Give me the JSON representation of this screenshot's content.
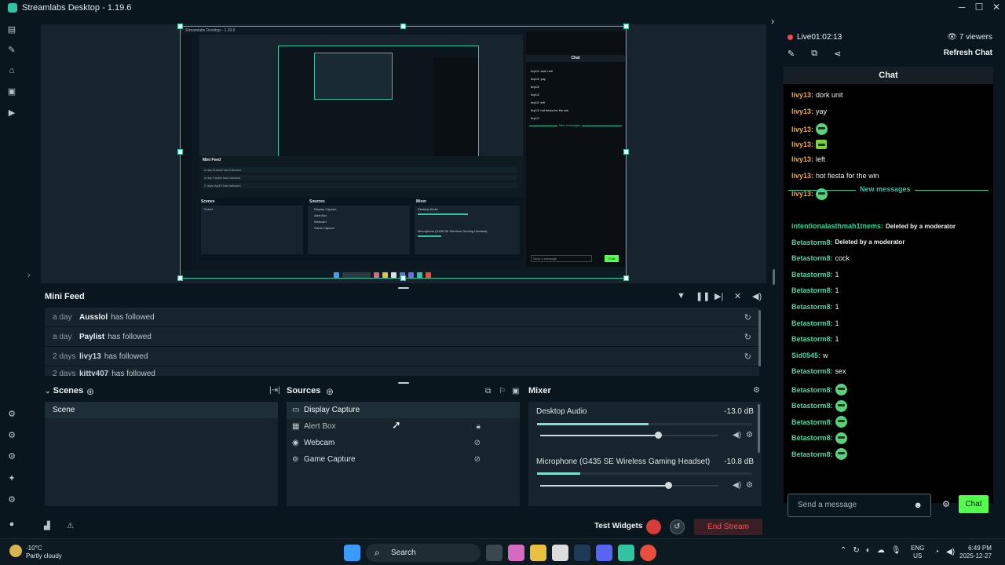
{
  "window": {
    "title": "Streamlabs Desktop - 1.19.6"
  },
  "rail_icons": [
    "editor-icon",
    "themes-icon",
    "store-icon",
    "layout-icon",
    "play-icon",
    "highlighter-icon",
    "apps-icon",
    "collab-icon",
    "sparkle-icon",
    "settings-icon",
    "profile-icon"
  ],
  "nested": {
    "title": "Streamlabs Desktop - 1.19.6",
    "feed_title": "Mini Feed",
    "feed_lines": [
      "a day  Ausslol  has followed",
      "a day  Paylist  has followed",
      "2 days  livy13  has followed"
    ],
    "scenes": "Scenes",
    "sources": "Sources",
    "mixer": "Mixer",
    "scene": "Scene",
    "source_rows": [
      "Display Capture",
      "Alert Box",
      "Webcam",
      "Game Capture"
    ],
    "desktop_audio": "Desktop Audio",
    "mic": "Microphone (G435 SE Wireless Gaming Headset)",
    "chat_header": "Chat",
    "new_messages": "New messages",
    "send": "Send a message",
    "chat_btn": "Chat",
    "chat_lines": [
      "livy13: dork unit",
      "livy13: yay",
      "livy13:",
      "livy13:",
      "livy13: left",
      "livy13: hot fiesta for the win",
      "livy13:"
    ]
  },
  "minifeed": {
    "title": "Mini Feed",
    "rows": [
      {
        "time": "a day",
        "name": "Ausslol",
        "action": "has followed"
      },
      {
        "time": "a day",
        "name": "Paylist",
        "action": "has followed"
      },
      {
        "time": "2 days",
        "name": "livy13",
        "action": "has followed"
      },
      {
        "time": "2 days",
        "name": "kitty407",
        "action": "has followed"
      }
    ]
  },
  "scenes": {
    "title": "Scenes",
    "items": [
      "Scene"
    ]
  },
  "sources": {
    "title": "Sources",
    "items": [
      {
        "label": "Display Capture",
        "icon": "monitor-icon"
      },
      {
        "label": "Alert Box",
        "icon": "alert-box-icon"
      },
      {
        "label": "Webcam",
        "icon": "webcam-icon"
      },
      {
        "label": "Game Capture",
        "icon": "gamepad-icon"
      }
    ]
  },
  "mixer": {
    "title": "Mixer",
    "channels": [
      {
        "label": "Desktop Audio",
        "db": "-13.0 dB",
        "level": 0.52,
        "volume": 0.66
      },
      {
        "label": "Microphone (G435 SE Wireless Gaming Headset)",
        "db": "-10.8 dB",
        "level": 0.2,
        "volume": 0.72
      }
    ]
  },
  "footer": {
    "test_widgets": "Test Widgets",
    "end_stream": "End Stream"
  },
  "chat": {
    "live_label": "Live",
    "live_time": "01:02:13",
    "viewers": "7 viewers",
    "refresh": "Refresh Chat",
    "header": "Chat",
    "new_messages": "New messages",
    "send_placeholder": "Send a message",
    "chat_button": "Chat",
    "messages": [
      {
        "user": "livy13",
        "text": "dork unit"
      },
      {
        "user": "livy13",
        "text": "yay"
      },
      {
        "user": "livy13",
        "text": ""
      },
      {
        "user": "livy13",
        "text": ""
      },
      {
        "user": "livy13",
        "text": "left"
      },
      {
        "user": "livy13",
        "text": "hot fiesta for the win"
      },
      {
        "user": "livy13",
        "text": ""
      }
    ],
    "new_msgs": [
      {
        "user": "intentionalasthmah1tnems",
        "text": "Deleted by a moderator"
      },
      {
        "user": "Betastorm8",
        "text": "Deleted by a moderator"
      },
      {
        "user": "Betastorm8",
        "text": "cock"
      },
      {
        "user": "Betastorm8",
        "text": "1"
      },
      {
        "user": "Betastorm8",
        "text": "1"
      },
      {
        "user": "Betastorm8",
        "text": "1"
      },
      {
        "user": "Betastorm8",
        "text": "1"
      },
      {
        "user": "Betastorm8",
        "text": "1"
      },
      {
        "user": "Sid0545",
        "text": "w"
      },
      {
        "user": "Betastorm8",
        "text": "sex"
      },
      {
        "user": "Betastorm8",
        "text": ""
      },
      {
        "user": "Betastorm8",
        "text": ""
      },
      {
        "user": "Betastorm8",
        "text": ""
      },
      {
        "user": "Betastorm8",
        "text": ""
      },
      {
        "user": "Betastorm8",
        "text": ""
      }
    ]
  },
  "taskbar": {
    "temp": "-10°C",
    "weather": "Partly cloudy",
    "search": "Search",
    "lang1": "ENG",
    "lang2": "US",
    "time": "6:49 PM",
    "date": "2025-12-27"
  }
}
